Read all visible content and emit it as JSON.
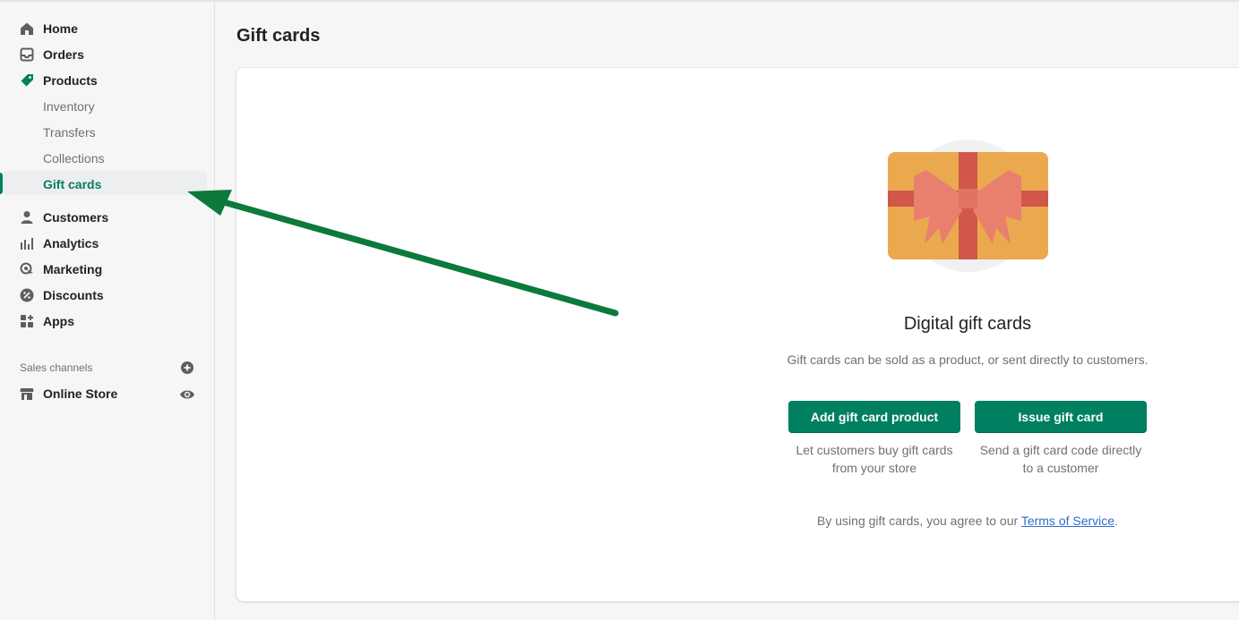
{
  "sidebar": {
    "items": [
      {
        "label": "Home",
        "icon": "home-icon"
      },
      {
        "label": "Orders",
        "icon": "inbox-icon"
      },
      {
        "label": "Products",
        "icon": "tag-icon"
      },
      {
        "label": "Customers",
        "icon": "person-icon"
      },
      {
        "label": "Analytics",
        "icon": "bar-chart-icon"
      },
      {
        "label": "Marketing",
        "icon": "target-icon"
      },
      {
        "label": "Discounts",
        "icon": "discount-icon"
      },
      {
        "label": "Apps",
        "icon": "apps-icon"
      }
    ],
    "product_subitems": [
      {
        "label": "Inventory"
      },
      {
        "label": "Transfers"
      },
      {
        "label": "Collections"
      },
      {
        "label": "Gift cards",
        "active": true
      }
    ],
    "sales_channels_title": "Sales channels",
    "channels": [
      {
        "label": "Online Store",
        "icon": "store-icon"
      }
    ]
  },
  "page": {
    "title": "Gift cards",
    "empty_state": {
      "heading": "Digital gift cards",
      "description": "Gift cards can be sold as a product, or sent directly to customers.",
      "primary_action": "Add gift card product",
      "primary_help": "Let customers buy gift cards from your store",
      "secondary_action": "Issue gift card",
      "secondary_help": "Send a gift card code directly to a customer",
      "terms_prefix": "By using gift cards, you agree to our ",
      "terms_link": "Terms of Service",
      "terms_suffix": "."
    }
  },
  "colors": {
    "accent": "#008060",
    "active_text": "#007f5f",
    "annotation_arrow": "#0b7a3b",
    "gift_card": "#eaa94f",
    "ribbon": "#d0574a",
    "bow": "#e9806e"
  }
}
